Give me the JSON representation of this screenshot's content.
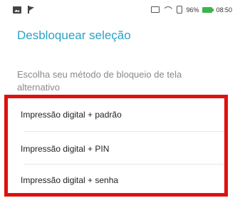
{
  "statusbar": {
    "battery": "96%",
    "time": "08:50",
    "left_icons": [
      "image-icon",
      "flag-icon"
    ],
    "right_icons": [
      "cast-icon",
      "wifi-icon",
      "phone-icon",
      "battery-icon"
    ]
  },
  "header": {
    "title": "Desbloquear seleção"
  },
  "description": "Escolha seu método de bloqueio de tela alternativo",
  "options": [
    {
      "label": "Impressão digital + padrão"
    },
    {
      "label": "Impressão digital + PIN"
    },
    {
      "label": "Impressão digital + senha"
    }
  ],
  "colors": {
    "title": "#2ba3c7",
    "highlight_border": "#e01010",
    "battery": "#3cb44b"
  }
}
